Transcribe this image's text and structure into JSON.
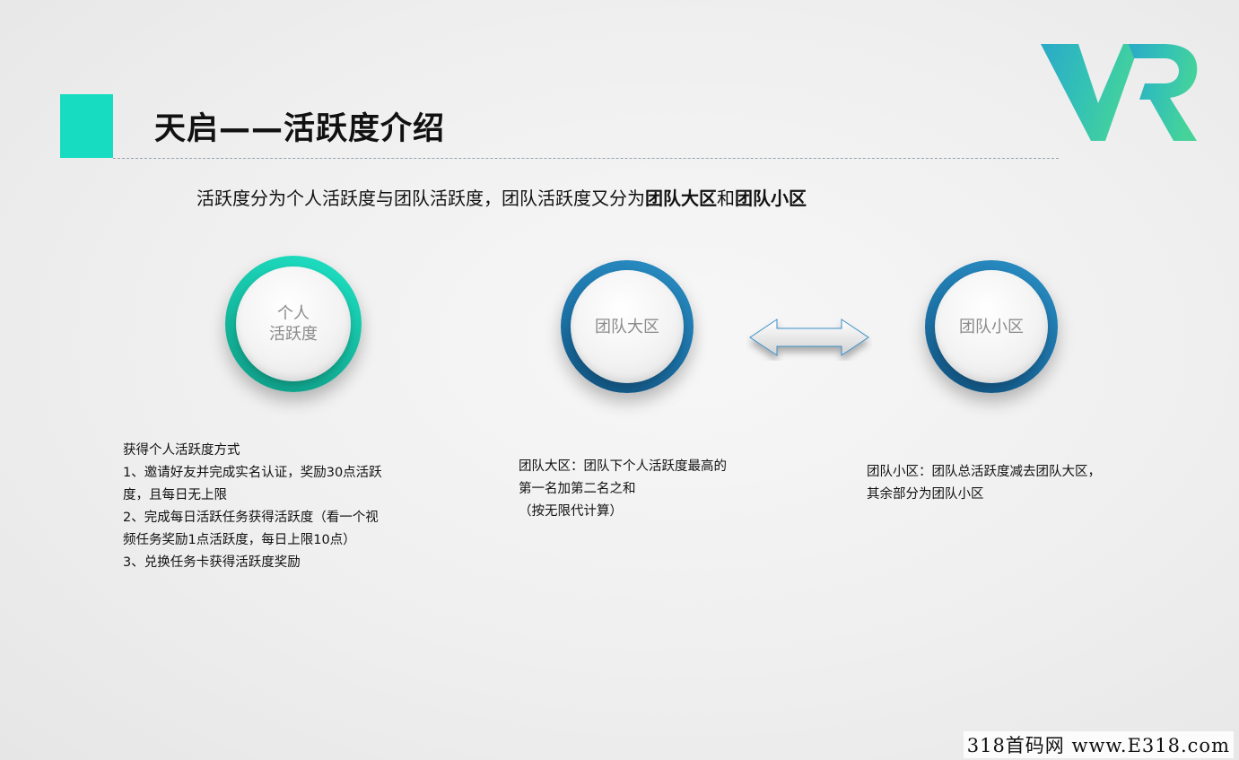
{
  "header": {
    "title": "天启——活跃度介绍"
  },
  "logo": {
    "icon": "vr-logo-icon",
    "colors": [
      "#2ab6c6",
      "#3bcfa4"
    ]
  },
  "subtitle": {
    "prefix": "活跃度分为个人活跃度与团队活跃度，团队活跃度又分为",
    "bold1": "团队大区",
    "middle": "和",
    "bold2": "团队小区"
  },
  "circles": {
    "personal": {
      "label": "个人\n活跃度",
      "color": "#17dcc2"
    },
    "big": {
      "label": "团队大区",
      "color": "#1b6fa3"
    },
    "small": {
      "label": "团队小区",
      "color": "#1b6fa3"
    }
  },
  "arrow": {
    "icon": "double-arrow-icon"
  },
  "personal_block": {
    "lines": [
      "获得个人活跃度方式",
      "1、邀请好友并完成实名认证，奖励30点活跃",
      "度，且每日无上限",
      "2、完成每日活跃任务获得活跃度（看一个视",
      "频任务奖励1点活跃度，每日上限10点）",
      "3、兑换任务卡获得活跃度奖励"
    ]
  },
  "big_block": {
    "lines": [
      "团队大区：团队下个人活跃度最高的",
      "第一名加第二名之和",
      "（按无限代计算）"
    ]
  },
  "small_block": {
    "lines": [
      "团队小区：团队总活跃度减去团队大区，",
      "其余部分为团队小区"
    ]
  },
  "watermark": {
    "text": "318首码网 www.E318.com"
  },
  "colors": {
    "accent": "#17dcc2",
    "blue": "#1b6fa3"
  }
}
